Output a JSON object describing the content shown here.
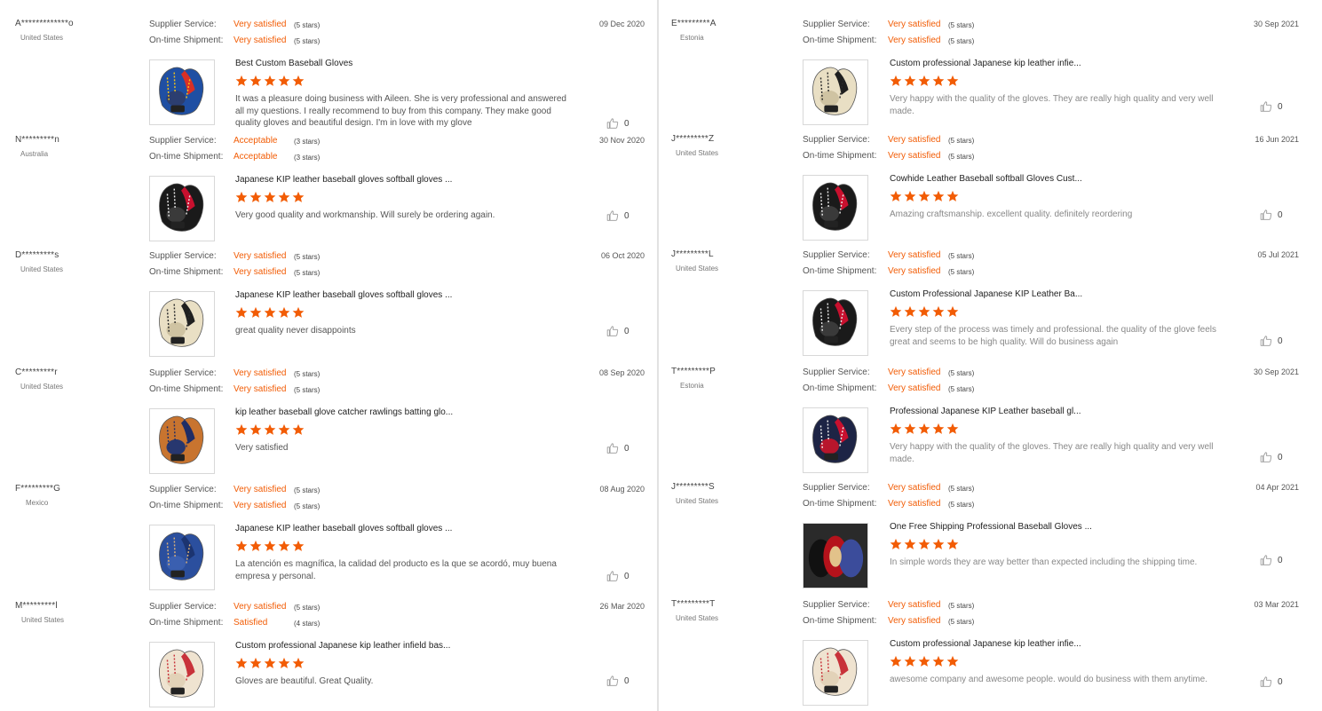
{
  "labels": {
    "supplier_service": "Supplier Service:",
    "ontime_shipment": "On-time Shipment:"
  },
  "colors": {
    "accent": "#f25c05",
    "star": "#f25c05",
    "divider": "#e2e2e2"
  },
  "left_reviews": [
    {
      "buyer": "A*************o",
      "country": "United States",
      "supplier_rating": "Very satisfied",
      "supplier_stars": "(5 stars)",
      "shipment_rating": "Very satisfied",
      "shipment_stars": "(5 stars)",
      "date": "09 Dec 2020",
      "product_title": "Best Custom Baseball Gloves",
      "review_stars": 5,
      "comment": "It was a pleasure doing business with Aileen. She is very professional and answered all my questions. I really recommend to buy from this company. They make good quality gloves and beautiful design. I'm in love with my glove",
      "likes": "0",
      "thumb_icon": "glove-blue-red-yellow"
    },
    {
      "buyer": "N*********n",
      "country": "Australia",
      "supplier_rating": "Acceptable",
      "supplier_stars": "(3 stars)",
      "shipment_rating": "Acceptable",
      "shipment_stars": "(3 stars)",
      "date": "30 Nov 2020",
      "product_title": "Japanese KIP leather baseball gloves softball gloves ...",
      "review_stars": 5,
      "comment": "Very good quality and workmanship. Will surely be ordering again.",
      "likes": "0",
      "thumb_icon": "glove-black-red"
    },
    {
      "buyer": "D*********s",
      "country": "United States",
      "supplier_rating": "Very satisfied",
      "supplier_stars": "(5 stars)",
      "shipment_rating": "Very satisfied",
      "shipment_stars": "(5 stars)",
      "date": "06 Oct 2020",
      "product_title": "Japanese KIP leather baseball gloves softball gloves ...",
      "review_stars": 5,
      "comment": "great quality never disappoints",
      "likes": "0",
      "thumb_icon": "glove-cream-black"
    },
    {
      "buyer": "C*********r",
      "country": "United States",
      "supplier_rating": "Very satisfied",
      "supplier_stars": "(5 stars)",
      "shipment_rating": "Very satisfied",
      "shipment_stars": "(5 stars)",
      "date": "08 Sep 2020",
      "product_title": "kip leather baseball glove catcher rawlings batting glo...",
      "review_stars": 5,
      "comment": "Very satisfied",
      "likes": "0",
      "thumb_icon": "glove-tan-navy"
    },
    {
      "buyer": "F*********G",
      "country": "Mexico",
      "supplier_rating": "Very satisfied",
      "supplier_stars": "(5 stars)",
      "shipment_rating": "Very satisfied",
      "shipment_stars": "(5 stars)",
      "date": "08 Aug 2020",
      "product_title": "Japanese KIP leather baseball gloves softball gloves ...",
      "review_stars": 5,
      "comment": "La atención es magnífica, la calidad del producto es la que se acordó, muy buena empresa y personal.",
      "likes": "0",
      "thumb_icon": "glove-blue"
    },
    {
      "buyer": "M*********l",
      "country": "United States",
      "supplier_rating": "Very satisfied",
      "supplier_stars": "(5 stars)",
      "shipment_rating": "Satisfied",
      "shipment_stars": "(4 stars)",
      "date": "26 Mar 2020",
      "product_title": "Custom professional Japanese kip leather infield bas...",
      "review_stars": 5,
      "comment": "Gloves are beautiful. Great Quality.",
      "likes": "0",
      "thumb_icon": "glove-cream-red"
    }
  ],
  "right_reviews": [
    {
      "buyer": "E*********A",
      "country": "Estonia",
      "supplier_rating": "Very satisfied",
      "supplier_stars": "(5 stars)",
      "shipment_rating": "Very satisfied",
      "shipment_stars": "(5 stars)",
      "date": "30 Sep 2021",
      "product_title": "Custom professional Japanese kip leather infie...",
      "review_stars": 5,
      "comment": "Very happy with the quality of the gloves. They are really high quality and very well made.",
      "likes": "0",
      "thumb_icon": "glove-cream-black"
    },
    {
      "buyer": "J*********Z",
      "country": "United States",
      "supplier_rating": "Very satisfied",
      "supplier_stars": "(5 stars)",
      "shipment_rating": "Very satisfied",
      "shipment_stars": "(5 stars)",
      "date": "16 Jun 2021",
      "product_title": "Cowhide Leather Baseball softball Gloves Cust...",
      "review_stars": 5,
      "comment": "Amazing craftsmanship. excellent quality. definitely reordering",
      "likes": "0",
      "thumb_icon": "glove-black-red"
    },
    {
      "buyer": "J*********L",
      "country": "United States",
      "supplier_rating": "Very satisfied",
      "supplier_stars": "(5 stars)",
      "shipment_rating": "Very satisfied",
      "shipment_stars": "(5 stars)",
      "date": "05 Jul 2021",
      "product_title": "Custom Professional Japanese KIP Leather Ba...",
      "review_stars": 5,
      "comment": "Every step of the process was timely and professional. the quality of the glove feels great and seems to be high quality. Will do business again",
      "likes": "0",
      "thumb_icon": "glove-black-red"
    },
    {
      "buyer": "T*********P",
      "country": "Estonia",
      "supplier_rating": "Very satisfied",
      "supplier_stars": "(5 stars)",
      "shipment_rating": "Very satisfied",
      "shipment_stars": "(5 stars)",
      "date": "30 Sep 2021",
      "product_title": "Professional Japanese KIP Leather baseball gl...",
      "review_stars": 5,
      "comment": "Very happy with the quality of the gloves. They are really high quality and very well made.",
      "likes": "0",
      "thumb_icon": "glove-navy-red-white"
    },
    {
      "buyer": "J*********S",
      "country": "United States",
      "supplier_rating": "Very satisfied",
      "supplier_stars": "(5 stars)",
      "shipment_rating": "Very satisfied",
      "shipment_stars": "(5 stars)",
      "date": "04 Apr 2021",
      "product_title": "One Free Shipping Professional Baseball Gloves ...",
      "review_stars": 5,
      "comment": "In simple words they are way better than expected including the shipping time.",
      "likes": "0",
      "thumb_icon": "gloves-dark-group"
    },
    {
      "buyer": "T*********T",
      "country": "United States",
      "supplier_rating": "Very satisfied",
      "supplier_stars": "(5 stars)",
      "shipment_rating": "Very satisfied",
      "shipment_stars": "(5 stars)",
      "date": "03 Mar 2021",
      "product_title": "Custom professional Japanese kip leather infie...",
      "review_stars": 5,
      "comment": "awesome company and awesome people. would do business with them anytime.",
      "likes": "0",
      "thumb_icon": "glove-cream-red"
    }
  ]
}
